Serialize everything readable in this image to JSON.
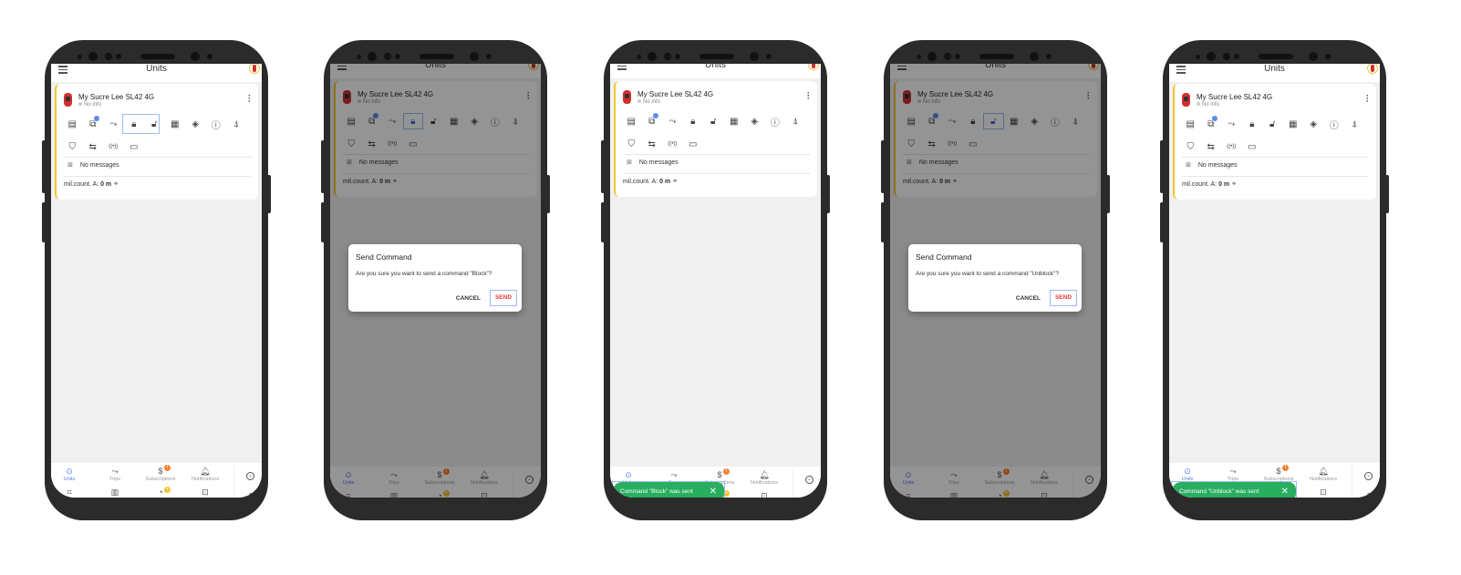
{
  "screens": [
    {
      "appbar_title": "Units",
      "unit": {
        "name": "My Sucre Lee SL42 4G",
        "status": "No info"
      },
      "messages": "No messages",
      "mileage_label": "mil.count. A:",
      "mileage_value": "0 m",
      "highlight": "block-and-unblock-icons"
    },
    {
      "appbar_title": "Units",
      "unit": {
        "name": "My Sucre Lee SL42 4G",
        "status": "No info"
      },
      "messages": "No messages",
      "mileage_label": "mil.count. A:",
      "mileage_value": "0 m",
      "dialog": {
        "title": "Send Command",
        "body": "Are you sure you want to send a command \"Block\"?",
        "cancel": "CANCEL",
        "send": "SEND"
      }
    },
    {
      "appbar_title": "Units",
      "unit": {
        "name": "My Sucre Lee SL42 4G",
        "status": "No info"
      },
      "messages": "No messages",
      "mileage_label": "mil.count. A:",
      "mileage_value": "0 m",
      "snackbar": "Command \"Block\" was sent"
    },
    {
      "appbar_title": "Units",
      "unit": {
        "name": "My Sucre Lee SL42 4G",
        "status": "No info"
      },
      "messages": "No messages",
      "mileage_label": "mil.count. A:",
      "mileage_value": "0 m",
      "dialog": {
        "title": "Send Command",
        "body": "Are you sure you want to send a command \"Unblock\"?",
        "cancel": "CANCEL",
        "send": "SEND"
      }
    },
    {
      "appbar_title": "Units",
      "unit": {
        "name": "My Sucre Lee SL42 4G",
        "status": "No info"
      },
      "messages": "No messages",
      "mileage_label": "mil.count. A:",
      "mileage_value": "0 m",
      "snackbar": "Command \"Unblock\" was sent"
    }
  ],
  "command_icons_row1": [
    {
      "name": "report-icon",
      "glyph": "▤"
    },
    {
      "name": "messages-icon",
      "glyph": "⧉"
    },
    {
      "name": "trips-icon",
      "glyph": "⤳"
    },
    {
      "name": "block-lock-icon",
      "glyph": "🔒︎"
    },
    {
      "name": "unblock-lock-icon",
      "glyph": "🔓︎"
    },
    {
      "name": "history-icon",
      "glyph": "▦"
    },
    {
      "name": "route-icon",
      "glyph": "◈"
    },
    {
      "name": "info-icon",
      "glyph": "ⓘ"
    },
    {
      "name": "navigation-icon",
      "glyph": "⍋"
    }
  ],
  "command_icons_row2": [
    {
      "name": "shield-icon",
      "glyph": "⛉"
    },
    {
      "name": "switch-icon",
      "glyph": "⇆"
    },
    {
      "name": "signal-icon",
      "glyph": "((•))"
    },
    {
      "name": "calendar-settings-icon",
      "glyph": "▭"
    }
  ],
  "bottom_nav": [
    {
      "label": "Units",
      "glyph": "⊙",
      "active": true
    },
    {
      "label": "Trips",
      "glyph": "⤳"
    },
    {
      "label": "Subscriptions",
      "glyph": "$",
      "badge": "!"
    },
    {
      "label": "Notifications",
      "glyph": "🔔︎"
    }
  ],
  "bottom_nav_row2": [
    {
      "name": "geofence-icon",
      "glyph": "⌗"
    },
    {
      "name": "stats-icon",
      "glyph": "▥"
    },
    {
      "name": "time-icon",
      "glyph": "◔",
      "badge": "•"
    },
    {
      "name": "widgets-icon",
      "glyph": "⊡"
    }
  ],
  "nav_more_glyph": "⌄",
  "colors": {
    "accent": "#4d7fe8",
    "send": "#e53935",
    "snackbar": "#27ae5f",
    "highlight": "#9dbcf0",
    "card_border": "#f3c531",
    "badge": "#f4822a"
  }
}
